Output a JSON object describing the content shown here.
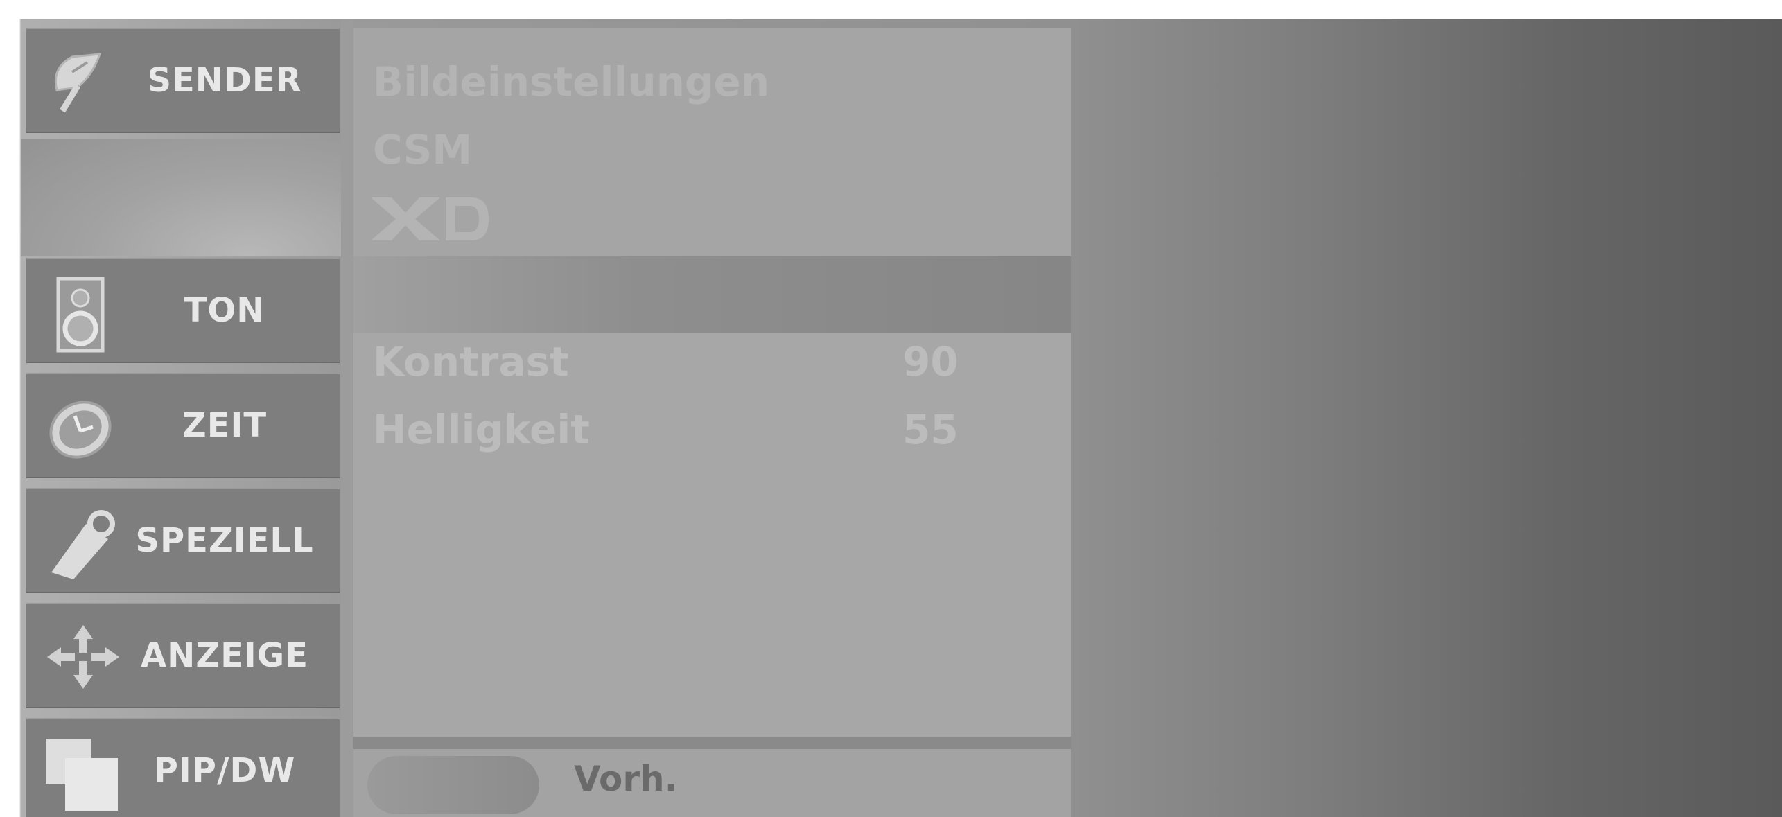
{
  "menu": [
    {
      "label": "SENDER",
      "icon": "satellite-dish-icon"
    },
    {
      "label": "TON",
      "icon": "speaker-icon"
    },
    {
      "label": "ZEIT",
      "icon": "clock-icon"
    },
    {
      "label": "SPEZIELL",
      "icon": "tag-icon"
    },
    {
      "label": "ANZEIGE",
      "icon": "move-arrows-icon"
    },
    {
      "label": "PIP/DW",
      "icon": "pip-icon"
    }
  ],
  "picture_menu": {
    "items_faded": [
      "Bildeinstellungen",
      "CSM",
      "XD"
    ],
    "options": [
      {
        "label": "Kontrast",
        "value": "90"
      },
      {
        "label": "Helligkeit",
        "value": "55"
      }
    ]
  },
  "footer": {
    "prev_label": "Vorh."
  }
}
